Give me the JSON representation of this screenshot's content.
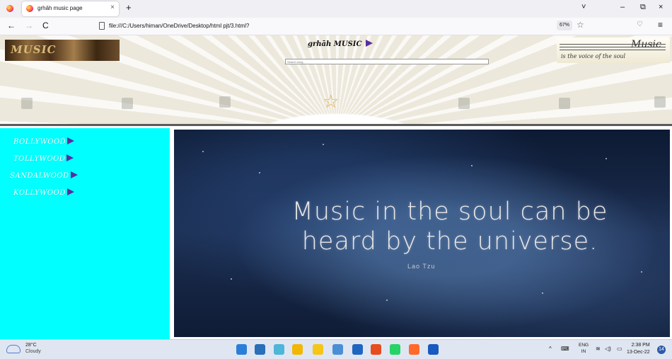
{
  "browser": {
    "tab_title": "grhāh music page",
    "tab_close": "×",
    "new_tab": "+",
    "back": "←",
    "forward": "→",
    "reload": "C",
    "url": "file:///C:/Users/himan/OneDrive/Desktop/html pjt/3.html?",
    "zoom": "67%",
    "bookmark": "☆",
    "pocket": "♡",
    "menu": "≡",
    "win_list": "˅",
    "win_min": "–",
    "win_max": "⧉",
    "win_close": "×"
  },
  "header": {
    "logo_text": "MUSIC",
    "title": "grhāh MUSIC",
    "search_placeholder": "Search song..",
    "right_logo_title": "Music",
    "right_logo_tagline": "is the voice of the soul"
  },
  "sidebar": {
    "items": [
      {
        "label": "BOLLYWOOD"
      },
      {
        "label": "TOLLYWOOD"
      },
      {
        "label": "SANDALWOOD"
      },
      {
        "label": "KOLLYWOOD"
      }
    ]
  },
  "hero": {
    "quote_line1": "Music in the soul can be",
    "quote_line2": "heard by the universe.",
    "author": "Lao Tzu"
  },
  "taskbar": {
    "temperature": "28°C",
    "condition": "Cloudy",
    "lang_line1": "ENG",
    "lang_line2": "IN",
    "time": "2:38 PM",
    "date": "13-Dec-22",
    "notifications": "14",
    "colors": {
      "start": "#2b7fd8",
      "search": "#2a6fb8",
      "app1": "#4db6d9",
      "app2": "#f2b705",
      "app3": "#f5c518",
      "app4": "#4a8fd6",
      "app5": "#1f66c1",
      "app6": "#e74c1f",
      "app7": "#25d366",
      "app8": "#ff6a2a",
      "app9": "#185abd"
    }
  }
}
